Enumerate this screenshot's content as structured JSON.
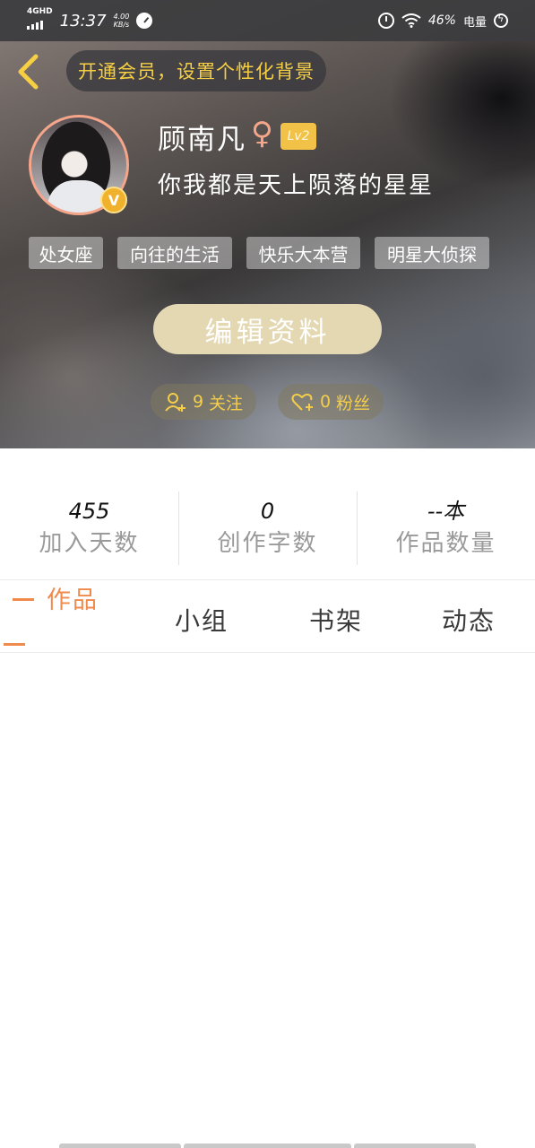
{
  "status_bar": {
    "network": "4GHD",
    "time": "13:37",
    "speed_value": "4.00",
    "speed_unit": "KB/s",
    "battery_percent": "46%",
    "battery_label": "电量"
  },
  "header": {
    "vip_prompt": "开通会员，设置个性化背景"
  },
  "profile": {
    "username": "顾南凡",
    "gender_symbol": "♀",
    "level": "Lv2",
    "verified_badge": "V",
    "signature": "你我都是天上陨落的星星",
    "tags": [
      "处女座",
      "向往的生活",
      "快乐大本营",
      "明星大侦探"
    ],
    "edit_button": "编辑资料",
    "following": {
      "count": "9",
      "label": "关注"
    },
    "followers": {
      "count": "0",
      "label": "粉丝"
    }
  },
  "stats": [
    {
      "value": "455",
      "label": "加入天数"
    },
    {
      "value": "0",
      "label": "创作字数"
    },
    {
      "value": "--本",
      "label": "作品数量"
    }
  ],
  "tabs": [
    {
      "label": "作品",
      "active": true
    },
    {
      "label": "小组",
      "active": false
    },
    {
      "label": "书架",
      "active": false
    },
    {
      "label": "动态",
      "active": false
    }
  ],
  "colors": {
    "accent_orange": "#ef8a4c",
    "gold": "#f4ce4a",
    "edit_button_bg": "#e4d8b2",
    "level_badge": "#f2c248"
  }
}
